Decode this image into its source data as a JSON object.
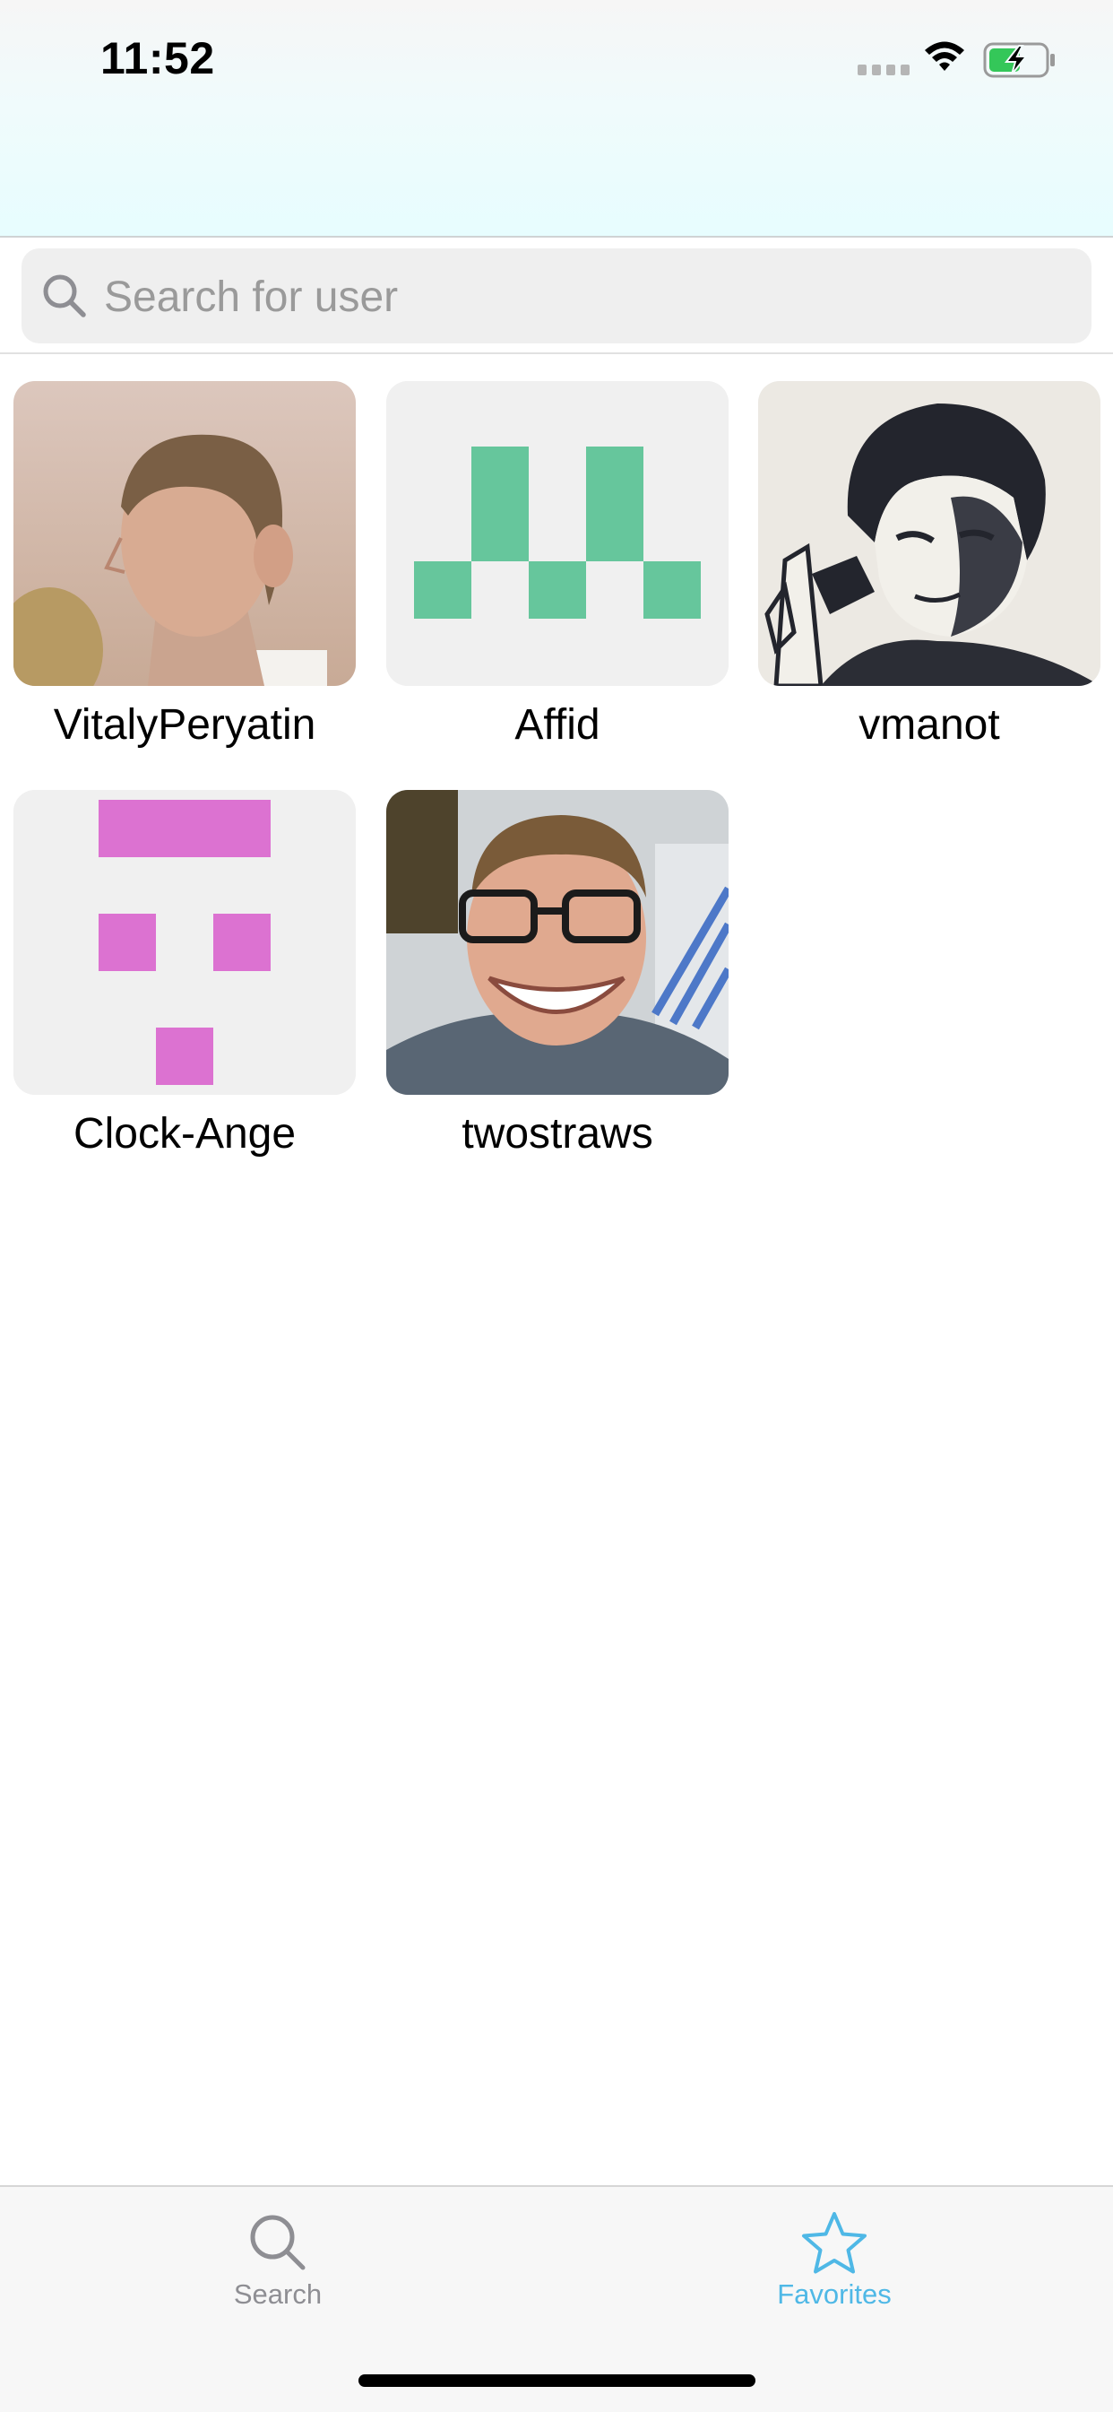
{
  "status_bar": {
    "time": "11:52",
    "battery_color": "#34c759"
  },
  "search": {
    "placeholder": "Search for user"
  },
  "favorites": [
    {
      "name": "VitalyPeryatin",
      "avatar": "photo-young-man-profile-icon"
    },
    {
      "name": "Affid",
      "avatar": "identicon-green",
      "color": "#66c69c"
    },
    {
      "name": "vmanot",
      "avatar": "sketch-portrait-icon"
    },
    {
      "name": "Clock-Ange",
      "avatar": "identicon-pink",
      "color": "#dc72d1"
    },
    {
      "name": "twostraws",
      "avatar": "photo-smiling-man-glasses-icon"
    }
  ],
  "tabbar": {
    "tabs": [
      {
        "label": "Search",
        "icon": "search-icon",
        "active": false
      },
      {
        "label": "Favorites",
        "icon": "star-icon",
        "active": true
      }
    ],
    "active_color": "#4fb8e6",
    "inactive_color": "#8e8e93"
  }
}
